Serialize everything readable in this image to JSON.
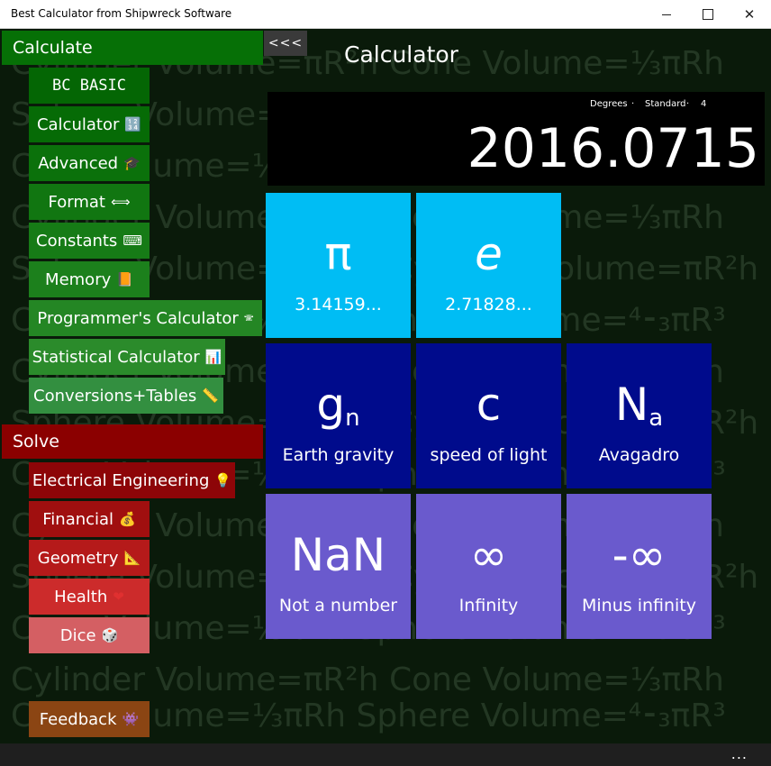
{
  "window": {
    "title": "Best Calculator from Shipwreck Software"
  },
  "background": {
    "lines": [
      "Cylinder Volume=πR²h   Cone Volume=⅓πRh",
      "Sphere Volume=⁴⁃₃πR³   Cylinder Volume=πR²h",
      "Cone Volume=⅓πRh   Sphere Volume=⁴⁃₃πR³"
    ]
  },
  "sidebar": {
    "calculate_header": "Calculate",
    "calculate_items": [
      {
        "label": "BC BASIC",
        "emoji": ""
      },
      {
        "label": "Calculator",
        "emoji": "🔢"
      },
      {
        "label": "Advanced",
        "emoji": "🎓"
      },
      {
        "label": "Format",
        "emoji": "⟺"
      },
      {
        "label": "Constants",
        "emoji": "⌨"
      },
      {
        "label": "Memory",
        "emoji": "📙"
      },
      {
        "label": "Programmer's Calculator",
        "emoji": "🕾"
      },
      {
        "label": "Statistical Calculator",
        "emoji": "📊"
      },
      {
        "label": "Conversions+Tables",
        "emoji": "📏"
      }
    ],
    "solve_header": "Solve",
    "solve_items": [
      {
        "label": "Electrical Engineering",
        "emoji": "💡"
      },
      {
        "label": "Financial",
        "emoji": "💰"
      },
      {
        "label": "Geometry",
        "emoji": "📐"
      },
      {
        "label": "Health",
        "emoji": "❤"
      },
      {
        "label": "Dice",
        "emoji": "🎲"
      }
    ],
    "feedback": {
      "label": "Feedback",
      "emoji": "👾"
    },
    "collapse_label": "<<<"
  },
  "main": {
    "title": "Calculator",
    "display": {
      "mode_angle": "Degrees",
      "mode_format": "Standard",
      "precision": "4",
      "separator": "·",
      "value": "2016.0715"
    },
    "tiles": [
      {
        "symbol": "π",
        "sub": "",
        "caption": "3.14159..."
      },
      {
        "symbol": "e",
        "sub": "",
        "caption": "2.71828..."
      },
      {
        "symbol": "g",
        "sub": "n",
        "caption": "Earth gravity"
      },
      {
        "symbol": "c",
        "sub": "",
        "caption": "speed of light"
      },
      {
        "symbol": "N",
        "sub": "a",
        "caption": "Avagadro"
      },
      {
        "symbol": "NaN",
        "sub": "",
        "caption": "Not a number"
      },
      {
        "symbol": "∞",
        "sub": "",
        "caption": "Infinity"
      },
      {
        "symbol": "-∞",
        "sub": "",
        "caption": "Minus infinity"
      }
    ]
  },
  "appbar": {
    "more_label": "..."
  },
  "colors": {
    "calculate_header": "#067006",
    "solve_header": "#8b0000",
    "tile_light": "#00bdf4",
    "tile_dark": "#000b8c",
    "tile_purple": "#6a5acd"
  }
}
